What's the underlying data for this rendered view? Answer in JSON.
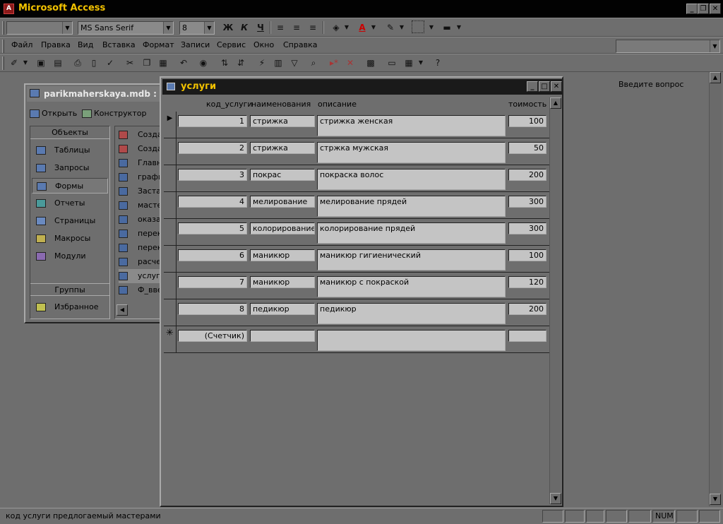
{
  "app": {
    "title": "Microsoft Access"
  },
  "format_toolbar": {
    "object_combo": "",
    "font_combo": "MS Sans Serif",
    "size_combo": "8",
    "bold": "Ж",
    "italic": "К",
    "underline": "Ч"
  },
  "menu": {
    "items": [
      "Файл",
      "Правка",
      "Вид",
      "Вставка",
      "Формат",
      "Записи",
      "Сервис",
      "Окно",
      "Справка"
    ],
    "question_placeholder": "Введите вопрос"
  },
  "db_window": {
    "title": "parikmaherskaya.mdb : б",
    "toolbar": {
      "open": "Открыть",
      "design": "Конструктор"
    },
    "objects_header": "Объекты",
    "nav": [
      "Таблицы",
      "Запросы",
      "Формы",
      "Отчеты",
      "Страницы",
      "Макросы",
      "Модули"
    ],
    "groups_header": "Группы",
    "favorites": "Избранное",
    "list": [
      "Созда",
      "Созда",
      "Главн",
      "графи",
      "Заста",
      "масте",
      "оказа",
      "перек",
      "перек",
      "расче",
      "услуг",
      "Ф_вве"
    ]
  },
  "form_window": {
    "title": "услуги",
    "columns": {
      "code": "код_услуги",
      "name": "наименования",
      "desc": "описание",
      "cost": "тоимость"
    },
    "rows": [
      {
        "code": "1",
        "name": "стрижка",
        "desc": "стрижка женская",
        "cost": "100"
      },
      {
        "code": "2",
        "name": "стрижка",
        "desc": "стржка мужская",
        "cost": "50"
      },
      {
        "code": "3",
        "name": "покрас",
        "desc": "покраска волос",
        "cost": "200"
      },
      {
        "code": "4",
        "name": "мелирование",
        "desc": "мелирование прядей",
        "cost": "300"
      },
      {
        "code": "5",
        "name": "колорирование",
        "desc": "колорирование прядей",
        "cost": "300"
      },
      {
        "code": "6",
        "name": "маникюр",
        "desc": "маникюр гигиенический",
        "cost": "100"
      },
      {
        "code": "7",
        "name": "маникюр",
        "desc": "маникюр с покраской",
        "cost": "120"
      },
      {
        "code": "8",
        "name": "педикюр",
        "desc": "педикюр",
        "cost": "200"
      }
    ],
    "new_row": {
      "code": "(Счетчик)",
      "name": "",
      "desc": "",
      "cost": ""
    }
  },
  "status_bar": {
    "text": "код услуги предлогаемый мастерами",
    "num": "NUM"
  },
  "colors": {
    "title_text": "#f2c200",
    "background": "#6e6e6e",
    "field_bg": "#c4c4c4"
  }
}
